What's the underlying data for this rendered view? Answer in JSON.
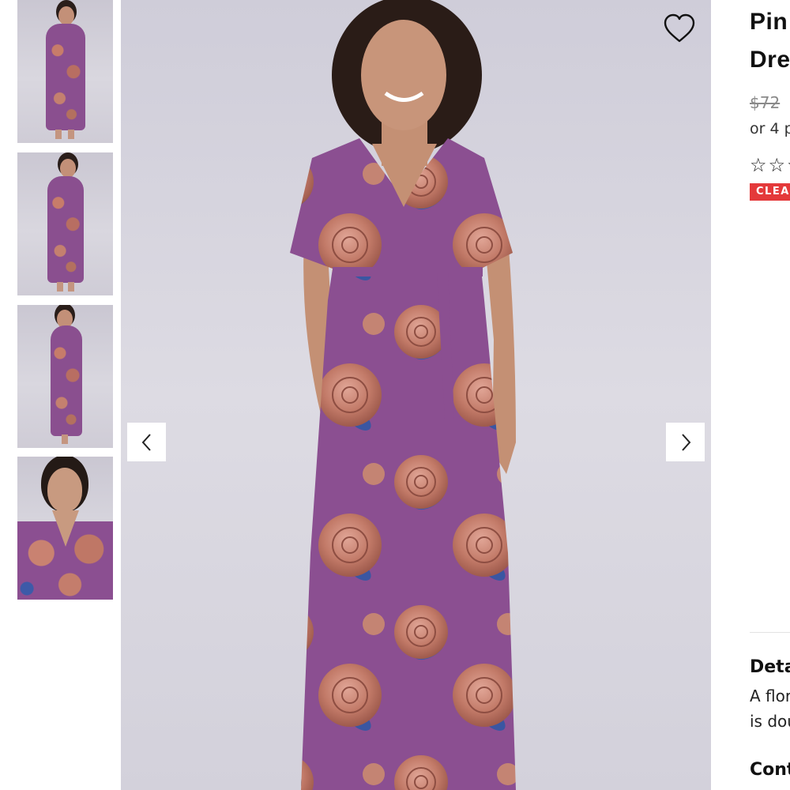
{
  "gallery": {
    "thumbnails": [
      {
        "view": "front-full"
      },
      {
        "view": "front-tie"
      },
      {
        "view": "side"
      },
      {
        "view": "close-up"
      }
    ],
    "main_view": "front-full",
    "prev_icon": "chevron-left-icon",
    "next_icon": "chevron-right-icon",
    "wishlist_icon": "heart-outline-icon"
  },
  "product": {
    "title_line1": "Pin",
    "title_line2": "Dre",
    "price_original": "$72",
    "installments_text": "or 4 p",
    "rating_stars": 0,
    "rating_max": 5,
    "badge": "CLEA",
    "badge_color": "#e4393a"
  },
  "details": {
    "heading": "Deta",
    "line1": "A flor",
    "line2": "is dou"
  },
  "contents": {
    "heading": "Cont"
  },
  "colors": {
    "dress_base": "#8b4f91",
    "rose": "#c47d6c",
    "leaf": "#3d5aa8"
  }
}
